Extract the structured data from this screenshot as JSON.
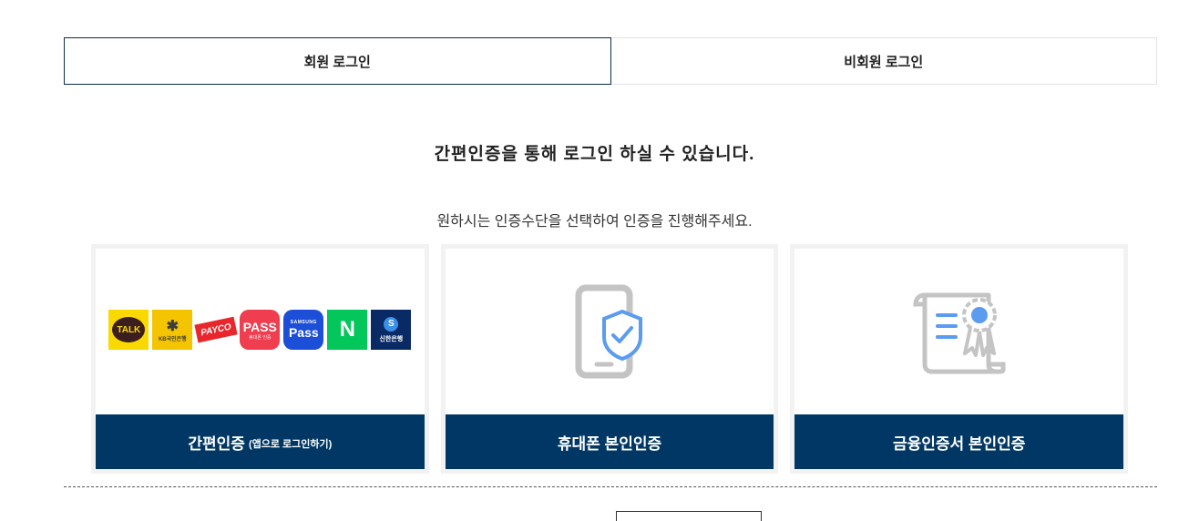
{
  "tabs": {
    "member": "회원 로그인",
    "guest": "비회원 로그인"
  },
  "heading": "간편인증을 통해 로그인 하실 수 있습니다.",
  "subheading": "원하시는 인증수단을 선택하여 인증을 진행해주세요.",
  "cards": {
    "simple": {
      "label": "간편인증",
      "sublabel": "(앱으로 로그인하기)",
      "logos": {
        "kakao": "TALK",
        "kb_text": "KB국민은행",
        "payco": "PAYCO",
        "pass": "PASS",
        "pass_sub": "휴대폰 인증",
        "samsung_top": "SAMSUNG",
        "samsung": "Pass",
        "naver": "N",
        "shinhan": "신한은행"
      }
    },
    "phone": {
      "label": "휴대폰 본인인증"
    },
    "certificate": {
      "label": "금융인증서 본인인증"
    }
  },
  "colors": {
    "primary": "#003764",
    "tab_border": "#0b2c4f",
    "icon_gray": "#c4c4c4",
    "icon_blue": "#5b9bf0"
  }
}
